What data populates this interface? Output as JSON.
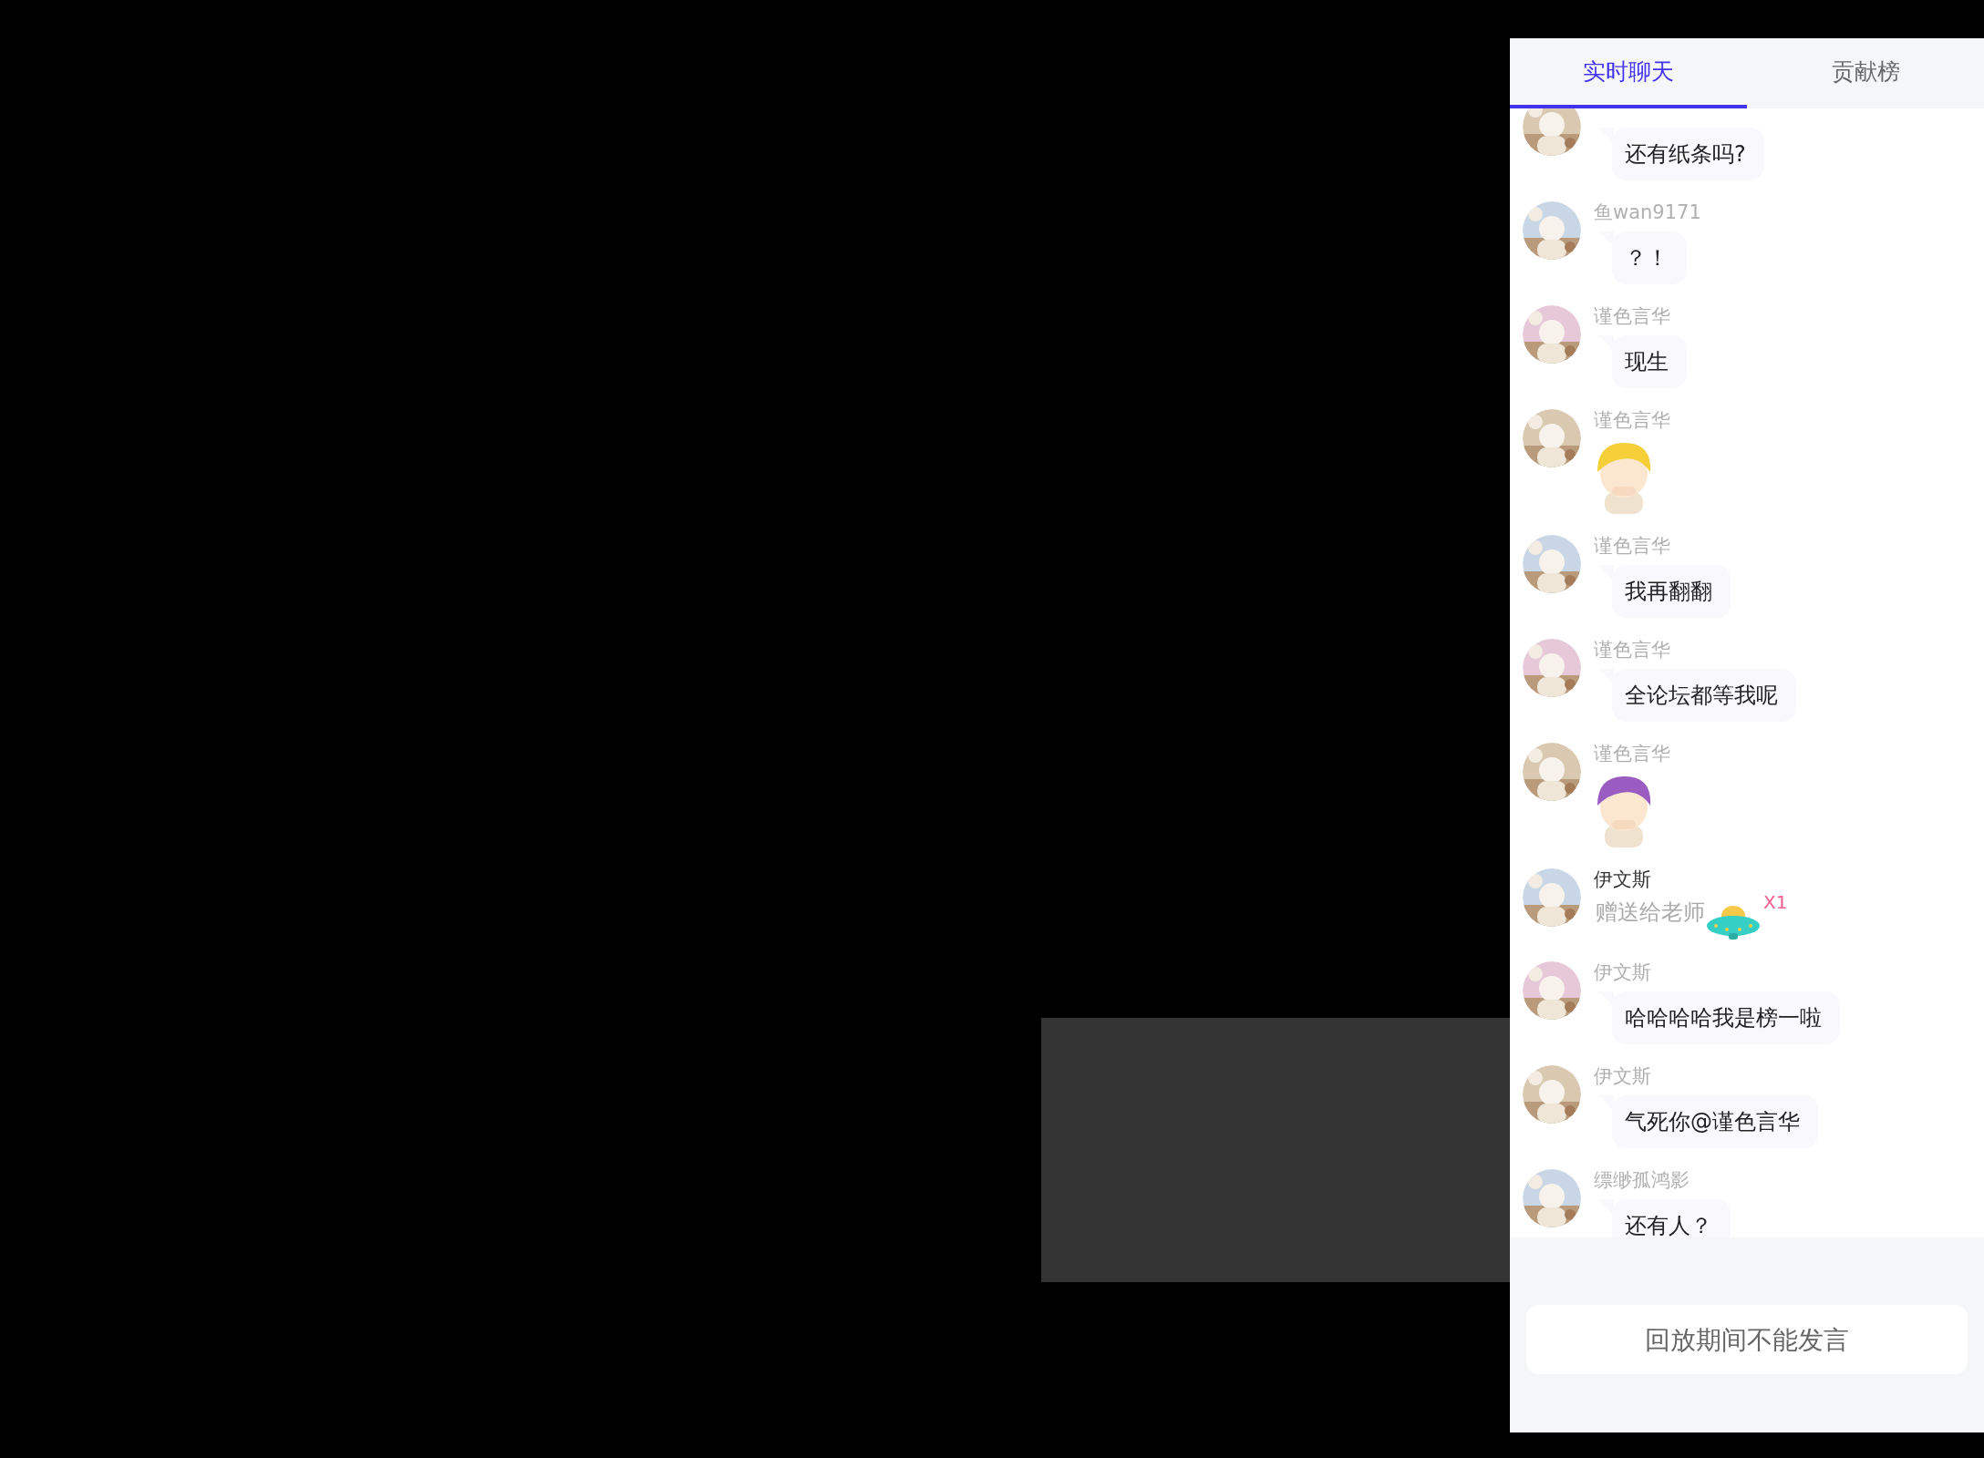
{
  "tabs": [
    {
      "label": "实时聊天",
      "selected": true
    },
    {
      "label": "贡献榜",
      "selected": false
    }
  ],
  "messages": [
    {
      "kind": "text",
      "text": "还有纸条吗?"
    },
    {
      "kind": "text",
      "name": "鱼wan9171",
      "text": "？！"
    },
    {
      "kind": "text",
      "name": "谨色言华",
      "text": "现生"
    },
    {
      "kind": "sticker",
      "name": "谨色言华"
    },
    {
      "kind": "text",
      "name": "谨色言华",
      "text": "我再翻翻"
    },
    {
      "kind": "text",
      "name": "谨色言华",
      "text": "全论坛都等我呢"
    },
    {
      "kind": "sticker",
      "name": "谨色言华"
    },
    {
      "kind": "gift",
      "name": "伊文斯",
      "text": "赠送给老师",
      "count": "X1"
    },
    {
      "kind": "text",
      "name": "伊文斯",
      "text": "哈哈哈哈我是榜一啦"
    },
    {
      "kind": "text",
      "name": "伊文斯",
      "text": "气死你@谨色言华"
    },
    {
      "kind": "text",
      "name": "缥缈孤鸿影",
      "text": "还有人？"
    }
  ],
  "input": {
    "placeholder": "回放期间不能发言"
  }
}
